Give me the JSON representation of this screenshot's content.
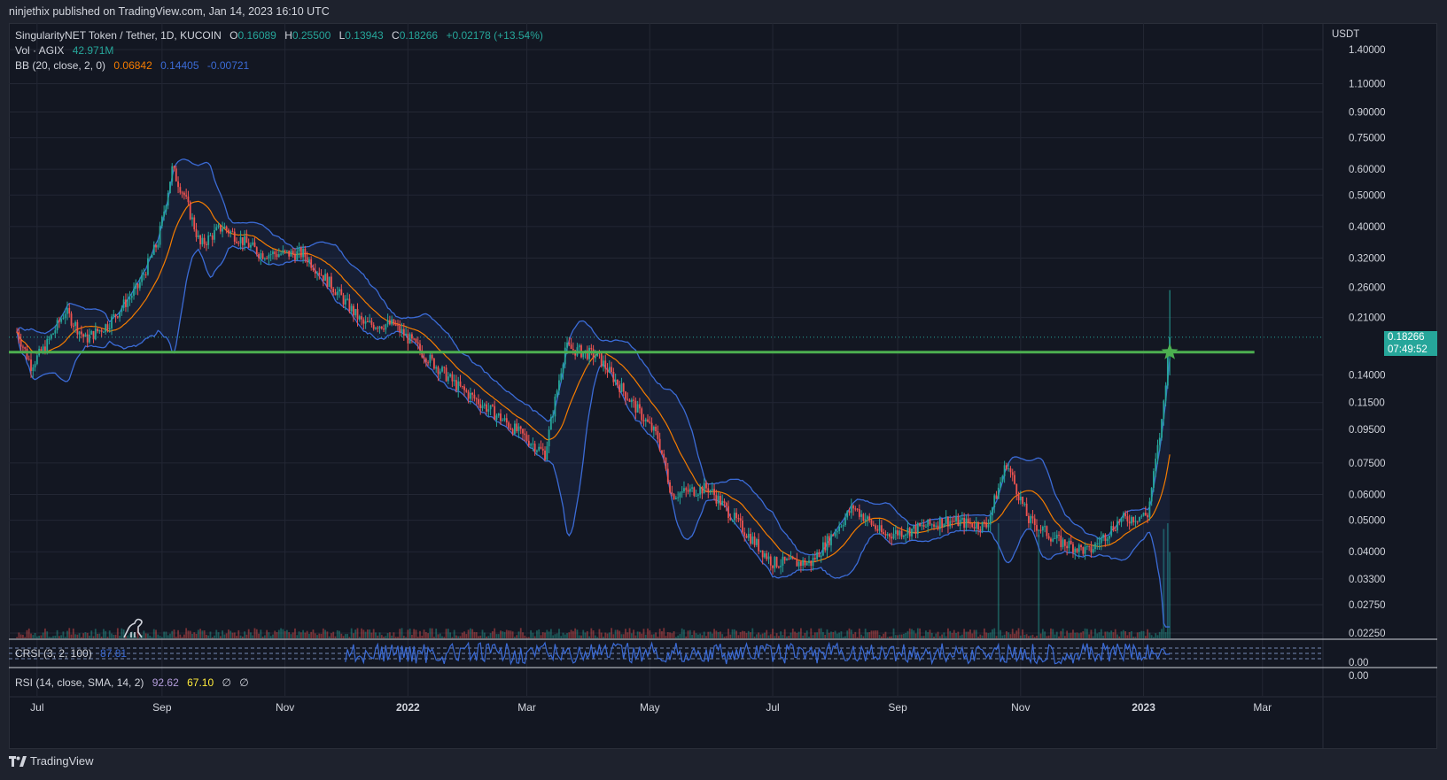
{
  "publish_line": "ninjethix published on TradingView.com, Jan 14, 2023 16:10 UTC",
  "legend": {
    "symbol": "SingularityNET Token / Tether, 1D, KUCOIN",
    "o_label": "O",
    "o_value": "0.16089",
    "h_label": "H",
    "h_value": "0.25500",
    "l_label": "L",
    "l_value": "0.13943",
    "c_label": "C",
    "c_value": "0.18266",
    "change": "+0.02178 (+13.54%)",
    "vol_label": "Vol · AGIX",
    "vol_value": "42.971M",
    "bb_label": "BB (20, close, 2, 0)",
    "bb_basis": "0.06842",
    "bb_upper": "0.14405",
    "bb_lower": "-0.00721"
  },
  "crsi": {
    "label": "CRSI (3, 2, 100)",
    "value": "87.81",
    "axis_label": "0.00"
  },
  "rsi": {
    "label": "RSI (14, close, SMA, 14, 2)",
    "value": "92.62",
    "sma": "67.10",
    "extra1": "∅",
    "extra2": "∅",
    "axis_label": "0.00"
  },
  "price_axis": {
    "currency": "USDT",
    "current_price": "0.18266",
    "countdown": "07:49:52"
  },
  "footer": {
    "brand": "TradingView"
  },
  "colors": {
    "background": "#131722",
    "up": "#26a69a",
    "down": "#ef5350",
    "bb_band": "#3b6bd6",
    "bb_basis": "#f57c00",
    "support_line": "#4caf50",
    "crsi": "#3b6bd6",
    "rsi_value": "#b39ddb",
    "rsi_sma": "#ffeb3b"
  },
  "icons": {
    "dino": "dinosaur-icon",
    "logo": "tradingview-logo-icon",
    "marker": "star-icon"
  },
  "chart_data": {
    "type": "candlestick",
    "title": "SingularityNET Token / Tether, 1D, KUCOIN",
    "y_scale": "log",
    "ylim": [
      0.0225,
      1.5
    ],
    "y_ticks": [
      1.4,
      1.1,
      0.9,
      0.75,
      0.6,
      0.5,
      0.4,
      0.32,
      0.26,
      0.21,
      0.14,
      0.115,
      0.095,
      0.075,
      0.06,
      0.05,
      0.04,
      0.033,
      0.0275,
      0.0225
    ],
    "y_tick_labels": [
      "1.40000",
      "1.10000",
      "0.90000",
      "0.75000",
      "0.60000",
      "0.50000",
      "0.40000",
      "0.32000",
      "0.26000",
      "0.21000",
      "0.14000",
      "0.11500",
      "0.09500",
      "0.07500",
      "0.06000",
      "0.05000",
      "0.04000",
      "0.03300",
      "0.02750",
      "0.02250"
    ],
    "x_range": [
      "2021-06-17",
      "2023-03-31"
    ],
    "x_ticks": [
      "2021-07-01",
      "2021-09-01",
      "2021-11-01",
      "2022-01-01",
      "2022-03-01",
      "2022-05-01",
      "2022-07-01",
      "2022-09-01",
      "2022-11-01",
      "2023-01-01",
      "2023-03-01"
    ],
    "x_tick_labels": [
      "Jul",
      "Sep",
      "Nov",
      "2022",
      "Mar",
      "May",
      "Jul",
      "Sep",
      "Nov",
      "2023",
      "Mar"
    ],
    "bold_ticks": [
      "2022",
      "2023"
    ],
    "series_close_anchors": [
      {
        "date": "2021-06-21",
        "close": 0.19
      },
      {
        "date": "2021-06-28",
        "close": 0.15
      },
      {
        "date": "2021-07-05",
        "close": 0.17
      },
      {
        "date": "2021-07-15",
        "close": 0.22
      },
      {
        "date": "2021-07-25",
        "close": 0.18
      },
      {
        "date": "2021-08-05",
        "close": 0.2
      },
      {
        "date": "2021-08-20",
        "close": 0.26
      },
      {
        "date": "2021-08-30",
        "close": 0.36
      },
      {
        "date": "2021-09-06",
        "close": 0.6
      },
      {
        "date": "2021-09-12",
        "close": 0.5
      },
      {
        "date": "2021-09-20",
        "close": 0.35
      },
      {
        "date": "2021-10-01",
        "close": 0.4
      },
      {
        "date": "2021-10-20",
        "close": 0.33
      },
      {
        "date": "2021-11-10",
        "close": 0.33
      },
      {
        "date": "2021-11-25",
        "close": 0.26
      },
      {
        "date": "2021-12-10",
        "close": 0.2
      },
      {
        "date": "2021-12-25",
        "close": 0.2
      },
      {
        "date": "2022-01-10",
        "close": 0.16
      },
      {
        "date": "2022-01-25",
        "close": 0.13
      },
      {
        "date": "2022-02-10",
        "close": 0.11
      },
      {
        "date": "2022-02-28",
        "close": 0.09
      },
      {
        "date": "2022-03-10",
        "close": 0.08
      },
      {
        "date": "2022-03-20",
        "close": 0.17
      },
      {
        "date": "2022-04-05",
        "close": 0.16
      },
      {
        "date": "2022-04-20",
        "close": 0.12
      },
      {
        "date": "2022-05-05",
        "close": 0.09
      },
      {
        "date": "2022-05-12",
        "close": 0.06
      },
      {
        "date": "2022-05-30",
        "close": 0.063
      },
      {
        "date": "2022-06-15",
        "close": 0.048
      },
      {
        "date": "2022-07-01",
        "close": 0.037
      },
      {
        "date": "2022-07-20",
        "close": 0.037
      },
      {
        "date": "2022-08-10",
        "close": 0.055
      },
      {
        "date": "2022-08-25",
        "close": 0.045
      },
      {
        "date": "2022-09-10",
        "close": 0.047
      },
      {
        "date": "2022-09-25",
        "close": 0.05
      },
      {
        "date": "2022-10-15",
        "close": 0.048
      },
      {
        "date": "2022-10-25",
        "close": 0.075
      },
      {
        "date": "2022-11-05",
        "close": 0.05
      },
      {
        "date": "2022-11-20",
        "close": 0.043
      },
      {
        "date": "2022-12-05",
        "close": 0.04
      },
      {
        "date": "2022-12-20",
        "close": 0.05
      },
      {
        "date": "2023-01-03",
        "close": 0.052
      },
      {
        "date": "2023-01-10",
        "close": 0.1
      },
      {
        "date": "2023-01-14",
        "close": 0.18266
      }
    ],
    "last_candle": {
      "open": 0.16089,
      "high": 0.255,
      "low": 0.13943,
      "close": 0.18266
    },
    "horizontal_line": {
      "price": 0.1644,
      "from": "2021-06-13",
      "to": "2023-02-25"
    },
    "bollinger": {
      "length": 20,
      "mult": 2,
      "basis": 0.06842,
      "upper": 0.14405,
      "lower": -0.00721
    },
    "volume_spikes": [
      {
        "date": "2022-10-21",
        "rel": 1.0
      },
      {
        "date": "2022-11-10",
        "rel": 0.9
      },
      {
        "date": "2023-01-11",
        "rel": 0.95
      },
      {
        "date": "2023-01-13",
        "rel": 1.0
      },
      {
        "date": "2023-01-14",
        "rel": 0.75
      }
    ]
  }
}
